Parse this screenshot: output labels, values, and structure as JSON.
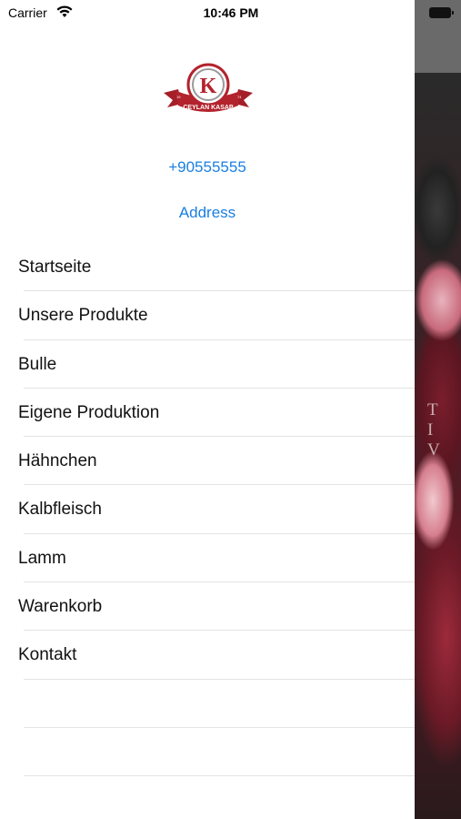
{
  "status_bar": {
    "carrier": "Carrier",
    "time": "10:46 PM"
  },
  "drawer": {
    "phone": "+90555555",
    "address": "Address",
    "menu": [
      {
        "label": "Startseite"
      },
      {
        "label": "Unsere Produkte"
      },
      {
        "label": "Bulle"
      },
      {
        "label": "Eigene Produktion"
      },
      {
        "label": "Hähnchen"
      },
      {
        "label": "Kalbfleisch"
      },
      {
        "label": "Lamm"
      },
      {
        "label": "Warenkorb"
      },
      {
        "label": "Kontakt"
      },
      {
        "label": ""
      },
      {
        "label": ""
      }
    ]
  },
  "background_app": {
    "overlay_text": "T I V"
  },
  "colors": {
    "link": "#1a7fe0",
    "logo_red": "#b3232d",
    "separator": "#e3e3e3"
  }
}
